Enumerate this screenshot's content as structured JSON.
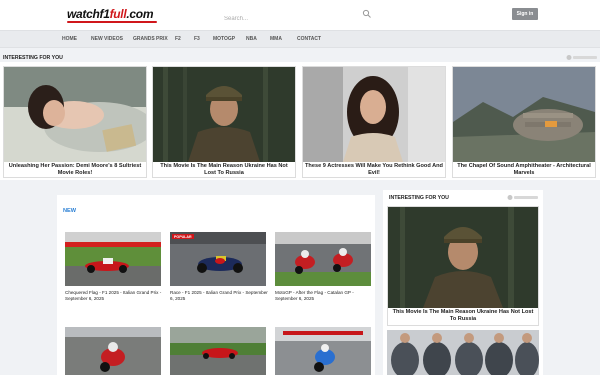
{
  "header": {
    "logo_part1": "watchf1",
    "logo_part2": "full",
    "logo_tld": ".com",
    "search_placeholder": "Search...",
    "signin_label": "Sign in"
  },
  "nav": [
    "HOME",
    "New Videos",
    "Grands Prix",
    "F2",
    "F3",
    "MotoGP",
    "NBA",
    "MMA",
    "Contact"
  ],
  "ify": {
    "title": "INTERESTING FOR YOU",
    "cards": [
      {
        "caption": "Unleashing Her Passion: Demi Moore's 8 Sultriest Movie Roles!"
      },
      {
        "caption": "This Movie Is The Main Reason Ukraine Has Not Lost To Russia"
      },
      {
        "caption": "These 9 Actresses Will Make You Rethink Good And Evil!"
      },
      {
        "caption": "The Chapel Of Sound Amphitheater - Architectural Marvels"
      }
    ]
  },
  "main": {
    "section_label": "NEW",
    "popular_badge": "POPULAR",
    "videos": [
      {
        "caption": "Chequered Flag - F1 2025 - Italian Grand Prix - September 6, 2025"
      },
      {
        "caption": "Race - F1 2025 - Italian Grand Prix - September 6, 2025"
      },
      {
        "caption": "MotoGP - After the Flag - Catalan GP - September 6, 2025"
      }
    ]
  },
  "right": {
    "title": "INTERESTING FOR YOU",
    "card_caption": "This Movie Is The Main Reason Ukraine Has Not Lost To Russia"
  },
  "colors": {
    "accent_red": "#d0171b",
    "link_blue": "#2a7fd4",
    "signin_grey": "#8a8d91"
  }
}
